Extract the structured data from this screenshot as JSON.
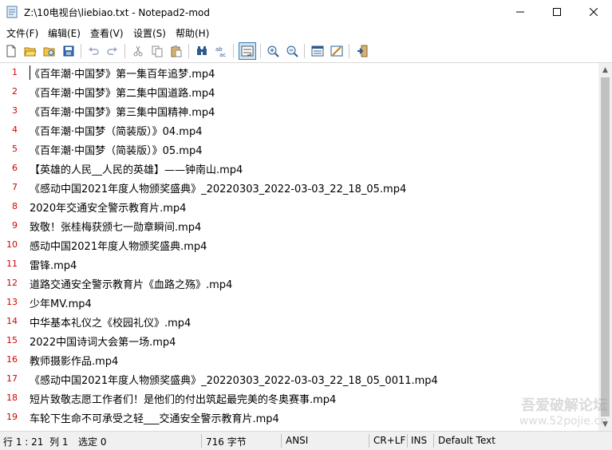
{
  "window": {
    "title": "Z:\\10电视台\\liebiao.txt - Notepad2-mod",
    "icon": "notepad-icon"
  },
  "menu": [
    {
      "label": "文件(F)"
    },
    {
      "label": "编辑(E)"
    },
    {
      "label": "查看(V)"
    },
    {
      "label": "设置(S)"
    },
    {
      "label": "帮助(H)"
    }
  ],
  "toolbar": [
    "new-file-icon",
    "open-folder-icon",
    "browse-icon",
    "save-icon",
    "undo-icon",
    "redo-icon",
    "cut-icon",
    "copy-icon",
    "paste-icon",
    "find-icon",
    "replace-icon",
    "word-wrap-icon",
    "zoom-in-icon",
    "zoom-out-icon",
    "view-scheme-icon",
    "customize-scheme-icon",
    "exit-icon"
  ],
  "editor": {
    "lines": [
      {
        "no": "1",
        "text": "《百年潮·中国梦》第一集百年追梦.mp4"
      },
      {
        "no": "2",
        "text": "《百年潮·中国梦》第二集中国道路.mp4"
      },
      {
        "no": "3",
        "text": "《百年潮·中国梦》第三集中国精神.mp4"
      },
      {
        "no": "4",
        "text": "《百年潮·中国梦（简装版）》04.mp4"
      },
      {
        "no": "5",
        "text": "《百年潮·中国梦（简装版）》05.mp4"
      },
      {
        "no": "6",
        "text": "【英雄的人民__人民的英雄】——钟南山.mp4"
      },
      {
        "no": "7",
        "text": "《感动中国2021年度人物颁奖盛典》_20220303_2022-03-03_22_18_05.mp4"
      },
      {
        "no": "8",
        "text": "2020年交通安全警示教育片.mp4"
      },
      {
        "no": "9",
        "text": "致敬！张桂梅获颁七一勋章瞬间.mp4"
      },
      {
        "no": "10",
        "text": "感动中国2021年度人物颁奖盛典.mp4"
      },
      {
        "no": "11",
        "text": "雷锋.mp4"
      },
      {
        "no": "12",
        "text": "道路交通安全警示教育片《血路之殇》.mp4"
      },
      {
        "no": "13",
        "text": "少年MV.mp4"
      },
      {
        "no": "14",
        "text": "中华基本礼仪之《校园礼仪》.mp4"
      },
      {
        "no": "15",
        "text": "2022中国诗词大会第一场.mp4"
      },
      {
        "no": "16",
        "text": "教师摄影作品.mp4"
      },
      {
        "no": "17",
        "text": "《感动中国2021年度人物颁奖盛典》_20220303_2022-03-03_22_18_05_0011.mp4"
      },
      {
        "no": "18",
        "text": "短片致敬志愿工作者们！是他们的付出筑起最完美的冬奥赛事.mp4"
      },
      {
        "no": "19",
        "text": "车轮下生命不可承受之轻___交通安全警示教育片.mp4"
      }
    ]
  },
  "status": {
    "position": "行 1 : 21",
    "column": "列 1",
    "selection": "选定 0",
    "size": "716 字节",
    "encoding": "ANSI",
    "line_ending": "CR+LF",
    "ins_mode": "INS",
    "scheme": "Default Text"
  },
  "watermark": {
    "title": "吾爱破解论坛",
    "url": "www.52pojie.cn"
  },
  "colors": {
    "line_number": "#d40000",
    "toolbar_active_border": "#3c7fb1",
    "toolbar_active_bg": "#cce4f7"
  }
}
